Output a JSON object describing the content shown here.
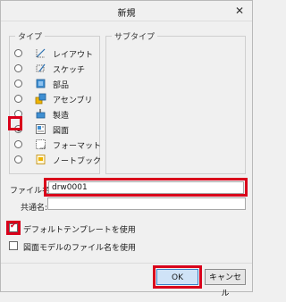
{
  "window": {
    "title": "新規"
  },
  "type_group": {
    "label": "タイプ",
    "items": [
      {
        "label": "レイアウト",
        "icon": "layout-icon",
        "checked": false
      },
      {
        "label": "スケッチ",
        "icon": "sketch-icon",
        "checked": false
      },
      {
        "label": "部品",
        "icon": "part-icon",
        "checked": false
      },
      {
        "label": "アセンブリ",
        "icon": "assembly-icon",
        "checked": false
      },
      {
        "label": "製造",
        "icon": "manufacturing-icon",
        "checked": false
      },
      {
        "label": "図面",
        "icon": "drawing-icon",
        "checked": true
      },
      {
        "label": "フォーマット",
        "icon": "format-icon",
        "checked": false
      },
      {
        "label": "ノートブック",
        "icon": "notebook-icon",
        "checked": false
      }
    ]
  },
  "subtype_group": {
    "label": "サブタイプ"
  },
  "fields": {
    "filename_label": "ファイル名:",
    "filename_value": "drw0001",
    "common_name_label": "共通名:",
    "common_name_value": ""
  },
  "options": {
    "use_default_template": {
      "label": "デフォルトテンプレートを使用",
      "checked": true
    },
    "use_model_filename": {
      "label": "図面モデルのファイル名を使用",
      "checked": false
    }
  },
  "buttons": {
    "ok": "OK",
    "cancel": "キャンセル"
  },
  "colors": {
    "highlight": "#d9001b",
    "ok_button": "#cfe3f7"
  }
}
